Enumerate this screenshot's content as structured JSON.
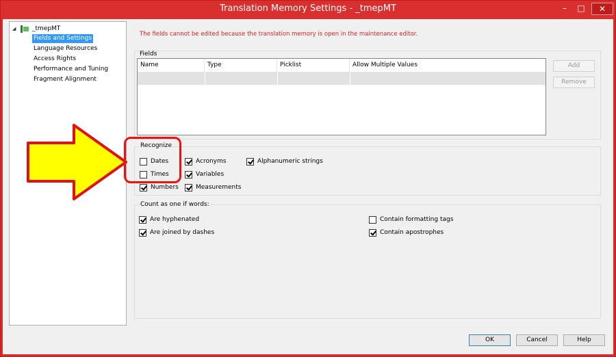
{
  "window": {
    "title": "Translation Memory Settings - _tmepMT",
    "minimize": "–",
    "maximize": "□",
    "close": "✕"
  },
  "tree": {
    "expander": "◢",
    "root_label": "_tmepMT",
    "items": [
      {
        "label": "Fields and Settings",
        "selected": true
      },
      {
        "label": "Language Resources"
      },
      {
        "label": "Access Rights"
      },
      {
        "label": "Performance and Tuning"
      },
      {
        "label": "Fragment Alignment"
      }
    ]
  },
  "warning": "The fields cannot be edited because the translation memory is open in the maintenance editor.",
  "fields": {
    "title": "Fields",
    "columns": [
      "Name",
      "Type",
      "Picklist",
      "Allow Multiple Values"
    ],
    "add_label": "Add",
    "remove_label": "Remove"
  },
  "recognize": {
    "title": "Recognize",
    "dates": {
      "label": "Dates",
      "checked": false
    },
    "times": {
      "label": "Times",
      "checked": false
    },
    "numbers": {
      "label": "Numbers",
      "checked": true
    },
    "acronyms": {
      "label": "Acronyms",
      "checked": true
    },
    "variables": {
      "label": "Variables",
      "checked": true
    },
    "measurements": {
      "label": "Measurements",
      "checked": true
    },
    "alphanumeric": {
      "label": "Alphanumeric strings",
      "checked": true
    }
  },
  "count": {
    "title": "Count as one if words:",
    "hyphenated": {
      "label": "Are hyphenated",
      "checked": true
    },
    "dashes": {
      "label": "Are joined by dashes",
      "checked": true
    },
    "formatting_tags": {
      "label": "Contain formatting tags",
      "checked": false
    },
    "apostrophes": {
      "label": "Contain apostrophes",
      "checked": true
    }
  },
  "footer": {
    "ok_label": "OK",
    "cancel_label": "Cancel",
    "help_label": "Help"
  },
  "colors": {
    "titlebar": "#d92f2f",
    "annotation_red": "#e11111",
    "arrow_fill": "#ffff00",
    "selection": "#3399ff",
    "warning_text": "#e52222"
  }
}
